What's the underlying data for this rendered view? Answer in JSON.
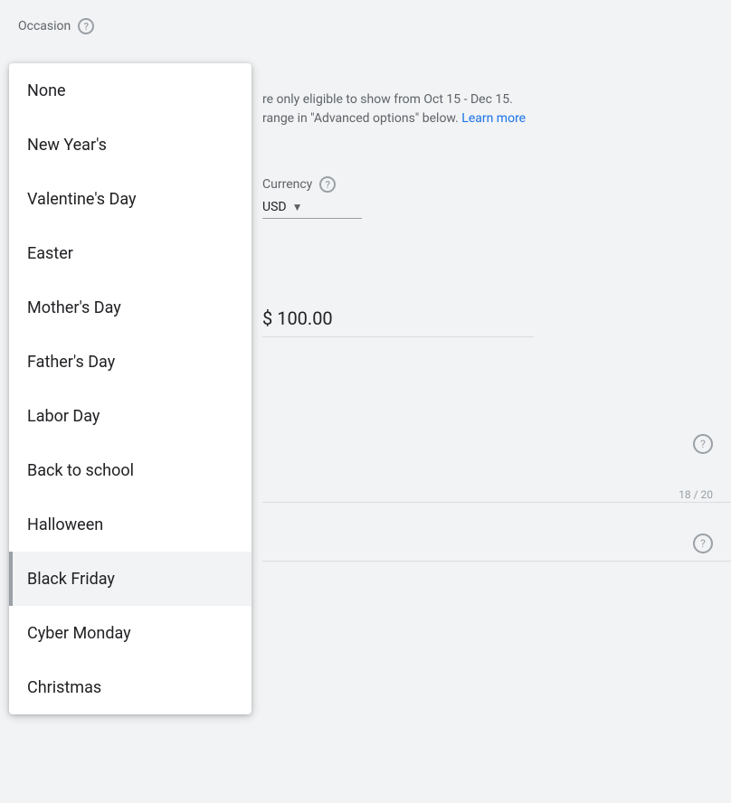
{
  "page": {
    "title": "Occasion",
    "occasion_label": "Occasion",
    "help_icon_label": "?",
    "info_text": "re only eligible to show from Oct 15 - Dec 15.",
    "info_text2": "range in \"Advanced options\" below.",
    "learn_more_label": "Learn more",
    "currency_label": "Currency",
    "currency_value": "USD",
    "price_value": "$ 100.00",
    "char_count": "18 / 20"
  },
  "dropdown": {
    "items": [
      {
        "id": "none",
        "label": "None",
        "selected": false
      },
      {
        "id": "new-years",
        "label": "New Year's",
        "selected": false
      },
      {
        "id": "valentines-day",
        "label": "Valentine's Day",
        "selected": false
      },
      {
        "id": "easter",
        "label": "Easter",
        "selected": false
      },
      {
        "id": "mothers-day",
        "label": "Mother's Day",
        "selected": false
      },
      {
        "id": "fathers-day",
        "label": "Father's Day",
        "selected": false
      },
      {
        "id": "labor-day",
        "label": "Labor Day",
        "selected": false
      },
      {
        "id": "back-to-school",
        "label": "Back to school",
        "selected": false
      },
      {
        "id": "halloween",
        "label": "Halloween",
        "selected": false
      },
      {
        "id": "black-friday",
        "label": "Black Friday",
        "selected": true
      },
      {
        "id": "cyber-monday",
        "label": "Cyber Monday",
        "selected": false
      },
      {
        "id": "christmas",
        "label": "Christmas",
        "selected": false
      }
    ]
  }
}
